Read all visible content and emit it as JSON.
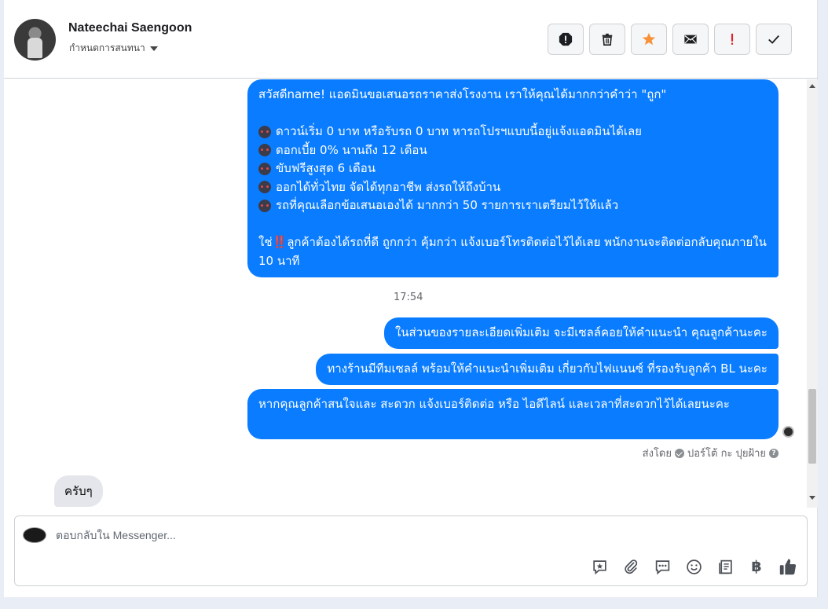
{
  "header": {
    "contact_name": "Nateechai Saengoon",
    "subtitle": "กำหนดการสนทนา",
    "actions": [
      {
        "name": "spam-button",
        "icon": "exclamation-octagon-icon"
      },
      {
        "name": "delete-button",
        "icon": "trash-icon"
      },
      {
        "name": "star-button",
        "icon": "star-icon",
        "color": "#f7923a"
      },
      {
        "name": "mark-unread-button",
        "icon": "envelope-icon"
      },
      {
        "name": "follow-up-button",
        "icon": "exclamation-icon",
        "color": "#e0242a"
      },
      {
        "name": "done-button",
        "icon": "check-icon"
      }
    ]
  },
  "messages": {
    "first": {
      "greeting": "สวัสดีname! แอดมินขอเสนอรถราคาส่งโรงงาน เราให้คุณได้มากกว่าคำว่า \"ถูก\"",
      "items": [
        "ดาวน์เริ่ม 0 บาท หรือรับรถ 0 บาท หารถโปรฯแบบนี้อยู่แจ้งแอดมินได้เลย",
        "ดอกเบี้ย 0% นานถึง 12 เดือน",
        "ขับฟรีสูงสุด 6 เดือน",
        "ออกได้ทั่วไทย จัดได้ทุกอาชีพ ส่งรถให้ถึงบ้าน",
        "รถที่คุณเลือกข้อเสนอเองได้ มากกว่า 50 รายการเราเตรียมไว้ให้แล้ว"
      ],
      "closing_prefix": "ใช่",
      "closing_mark": "‼️",
      "closing_text": "ลูกค้าต้องได้รถที่ดี ถูกกว่า คุ้มกว่า แจ้งเบอร์โทรติดต่อไว้ได้เลย พนักงานจะติดต่อกลับคุณภายใน 10 นาที"
    },
    "timestamp": "17:54",
    "second": "ในส่วนของรายละเอียดเพิ่มเติม จะมีเซลล์คอยให้คำแนะนำ คุณลูกค้านะคะ",
    "third": "ทางร้านมีทีมเซลล์ พร้อมให้คำแนะนำเพิ่มเติม เกี่ยวกับไฟแนนซ์ ที่รองรับลูกค้า BL นะคะ",
    "fourth": "หากคุณลูกค้าสนใจและ สะดวก แจ้งเบอร์ติดต่อ หรือ ไอดีไลน์ และเวลาที่สะดวกไว้ได้เลยนะคะ",
    "sent_by_label": "ส่งโดย",
    "sent_by_name": "ปอร์โต้ กะ ปุยฝ้าย",
    "incoming_reply": "ครับๆ"
  },
  "composer": {
    "placeholder": "ตอบกลับใน Messenger...",
    "tools": [
      "saved-reply-icon",
      "attachment-icon",
      "chat-bubble-icon",
      "emoji-icon",
      "document-icon",
      "baht-icon",
      "thumbs-up-icon"
    ],
    "baht_symbol": "฿"
  },
  "colors": {
    "outgoing_bubble": "#0a7cff",
    "incoming_bubble": "#e4e6eb",
    "like_icon": "#4b4f56"
  }
}
